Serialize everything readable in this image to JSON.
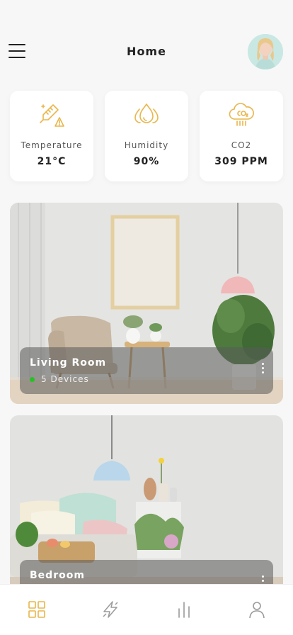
{
  "header": {
    "title": "Home"
  },
  "stats": [
    {
      "icon": "thermometer-icon",
      "label": "Temperature",
      "value": "21°C"
    },
    {
      "icon": "humidity-drops-icon",
      "label": "Humidity",
      "value": "90%"
    },
    {
      "icon": "co2-cloud-icon",
      "label": "CO2",
      "value": "309 PPM"
    }
  ],
  "rooms": [
    {
      "name": "Living Room",
      "devices": "5 Devices"
    },
    {
      "name": "Bedroom"
    }
  ],
  "tabs": [
    {
      "icon": "grid-icon",
      "active": true
    },
    {
      "icon": "lightning-icon",
      "active": false
    },
    {
      "icon": "bar-chart-icon",
      "active": false
    },
    {
      "icon": "profile-icon",
      "active": false
    }
  ],
  "colors": {
    "accent": "#E8B64C",
    "inactive_icon": "#9a9a9a",
    "status_online": "#25C225"
  }
}
